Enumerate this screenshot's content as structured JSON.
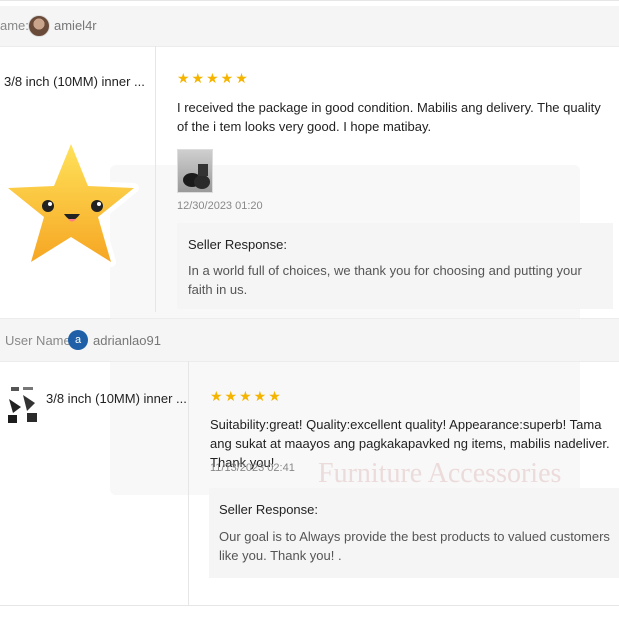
{
  "watermark": {
    "text": "Furniture Accessories"
  },
  "reviews": [
    {
      "user_label": "ame:",
      "username": "amiel4r",
      "avatar_letter": "",
      "product": "3/8 inch (10MM) inner ...",
      "stars": "★★★★★",
      "rating": 5,
      "review_text": "I received the package in good condition. Mabilis ang delivery. The quality of the i tem looks very good. I hope matibay.",
      "date": "12/30/2023 01:20",
      "seller_title": "Seller Response:",
      "seller_text": "In a world full of choices, we thank you for choosing and putting your faith in us."
    },
    {
      "user_label": "User Name:",
      "username": "adrianlao91",
      "avatar_letter": "a",
      "product": "3/8 inch (10MM) inner ...",
      "stars": "★★★★★",
      "rating": 5,
      "review_text": "Suitability:great! Quality:excellent quality! Appearance:superb! Tama ang sukat at maayos ang pagkakapavked ng items, mabilis nadeliver. Thank you!",
      "date": "11/13/2023 02:41",
      "seller_title": "Seller Response:",
      "seller_text": "Our goal is to Always provide the best products to valued customers like you. Thank you! ."
    }
  ],
  "colors": {
    "star": "#f5b400",
    "avatar_blue": "#1f5fa8",
    "header_bg": "#f5f5f5"
  }
}
